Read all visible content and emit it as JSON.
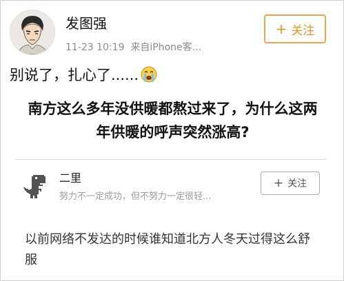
{
  "post": {
    "username": "发图强",
    "timestamp": "11-23 10:19",
    "source": "来自iPhone客...",
    "follow_label": "关注",
    "caption": "别说了，扎心了......",
    "caption_emoji": "crying-face-icon",
    "avatar_icon": "avatar"
  },
  "question": {
    "title": "南方这么多年没供暖都熬过来了，为什么这两年供暖的呼声突然涨高?"
  },
  "answer": {
    "author": "二里",
    "motto": "努力不一定成功，但不努力一定很轻...",
    "follow_label": "关注",
    "avatar_icon": "dinosaur-icon",
    "text": "以前网络不发达的时候谁知道北方人冬天过得这么舒服"
  },
  "colors": {
    "accent": "#e19428",
    "meta": "#8a8a8a",
    "divider": "#d8d8d8"
  }
}
